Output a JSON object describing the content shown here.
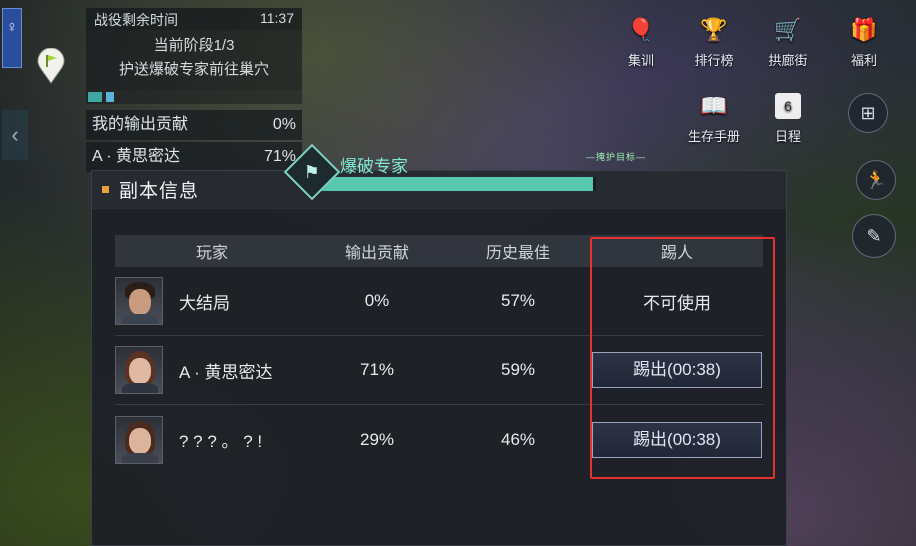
{
  "hud": {
    "timer_label": "战役剩余时间",
    "timer_value": "11:37",
    "stage": "当前阶段1/3",
    "objective": "护送爆破专家前往巢穴",
    "contrib_rows": [
      {
        "name": "我的输出贡献",
        "value": "0%"
      },
      {
        "name": "A · 黄思密达",
        "value": "71%"
      }
    ]
  },
  "menu": {
    "items": [
      {
        "label": "集训",
        "icon": "gift-balloon-icon"
      },
      {
        "label": "排行榜",
        "icon": "trophy-icon"
      },
      {
        "label": "拱廊街",
        "icon": "shop-cart-icon"
      },
      {
        "label": "福利",
        "icon": "gift-box-icon"
      },
      {
        "label": "生存手册",
        "icon": "book-icon"
      },
      {
        "label": "日程",
        "icon": "calendar-icon"
      }
    ],
    "calendar_badge": "6"
  },
  "role": {
    "name": "爆破专家",
    "progress": 0.99,
    "top_tag": "—掩护目标—"
  },
  "dialog": {
    "title": "副本信息",
    "columns": [
      "玩家",
      "输出贡献",
      "历史最佳",
      "踢人"
    ],
    "players": [
      {
        "name": "大结局",
        "contribution": "0%",
        "best": "57%",
        "kick": "不可使用",
        "kick_enabled": false,
        "avatar": "male-portrait",
        "hair": "#2a1e18"
      },
      {
        "name": "A · 黄思密达",
        "contribution": "71%",
        "best": "59%",
        "kick": "踢出(00:38)",
        "kick_enabled": true,
        "avatar": "female-portrait",
        "hair": "#5a3324"
      },
      {
        "name": "? ? ? 。 ? !",
        "contribution": "29%",
        "best": "46%",
        "kick": "踢出(00:38)",
        "kick_enabled": true,
        "avatar": "female-portrait",
        "hair": "#4a2a1e"
      }
    ]
  },
  "colors": {
    "accent": "#57c7b0",
    "highlight": "#e5302d"
  }
}
